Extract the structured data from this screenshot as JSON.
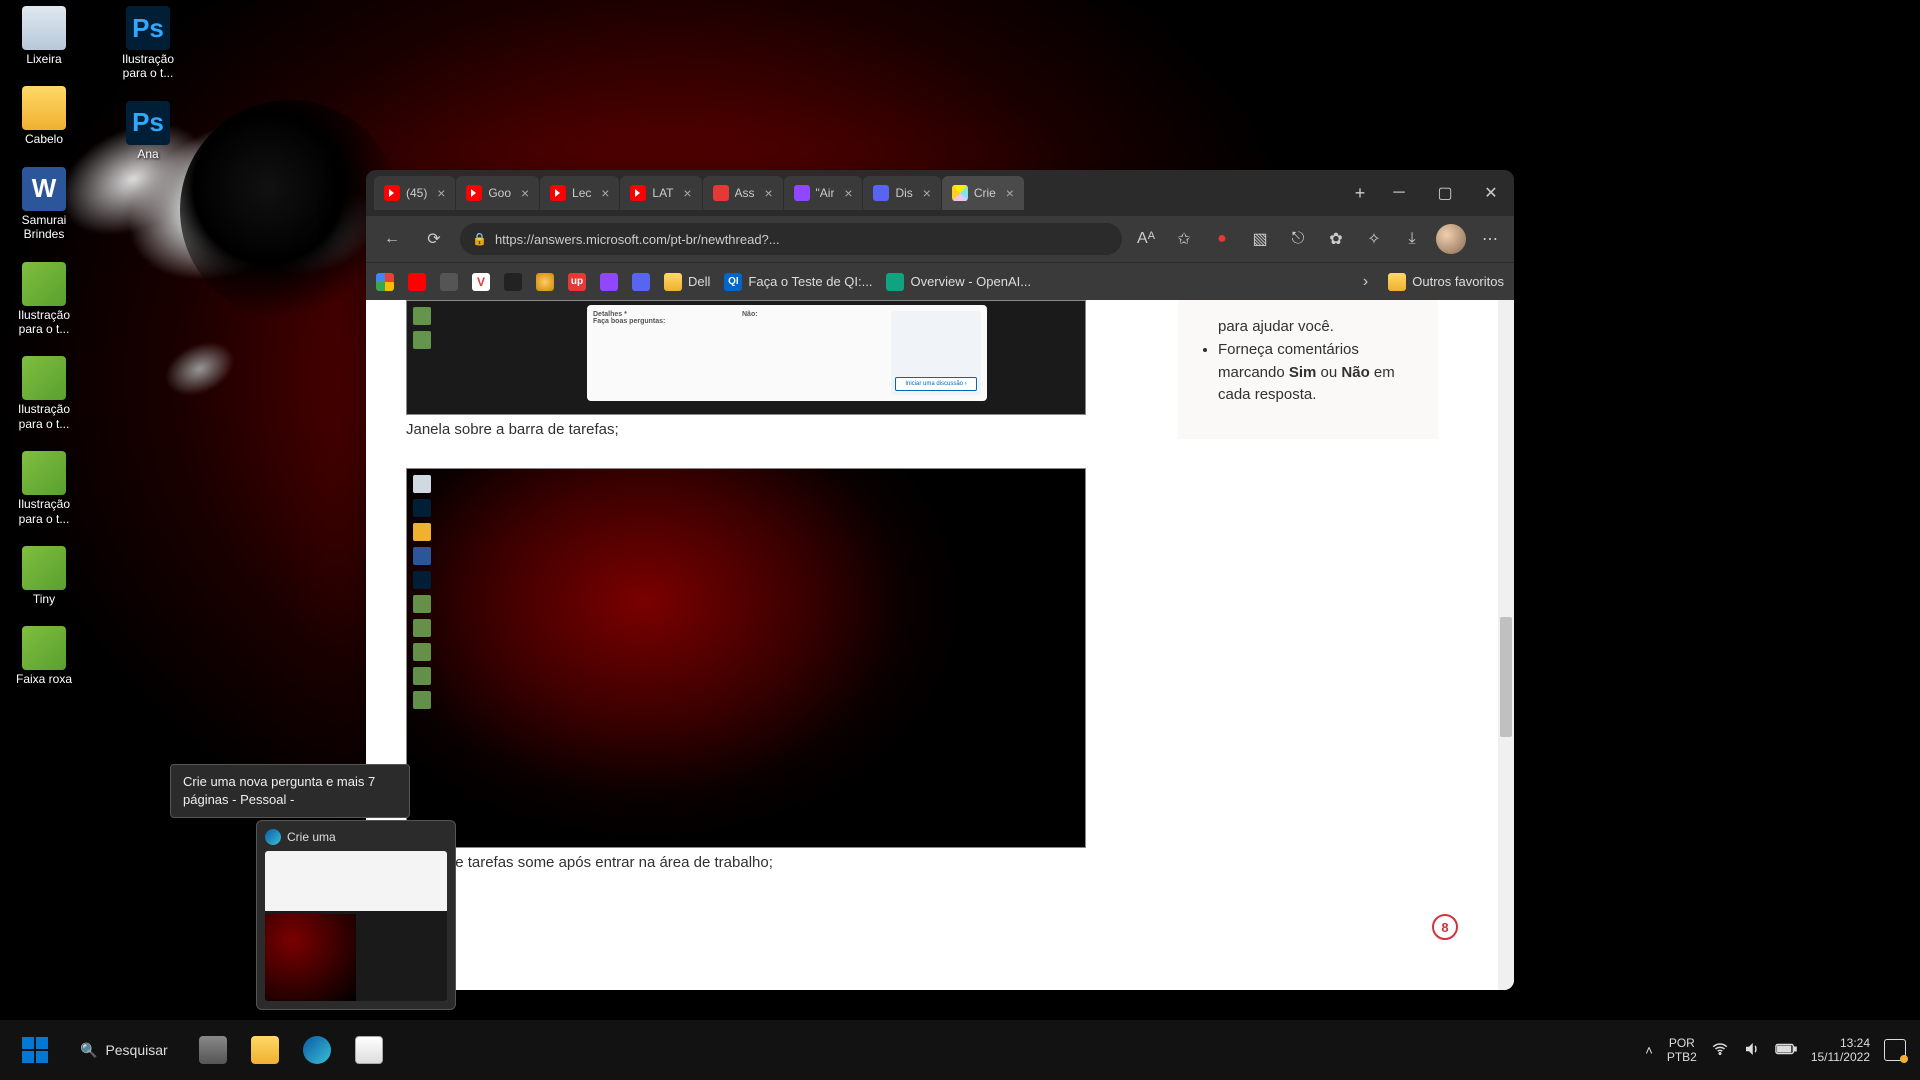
{
  "desktop_icons_col1": [
    {
      "label": "Lixeira",
      "cls": "ico-bin"
    },
    {
      "label": "Cabelo",
      "cls": "ico-folder"
    },
    {
      "label": "Samurai Brindes",
      "cls": "ico-word",
      "glyph": "W"
    },
    {
      "label": "Ilustração para o t...",
      "cls": "ico-img"
    },
    {
      "label": "Ilustração para o t...",
      "cls": "ico-img"
    },
    {
      "label": "Ilustração para o t...",
      "cls": "ico-img"
    },
    {
      "label": "Tiny",
      "cls": "ico-img"
    },
    {
      "label": "Faixa roxa",
      "cls": "ico-img"
    }
  ],
  "desktop_icons_col2": [
    {
      "label": "Ilustração para o t...",
      "cls": "ico-psd",
      "glyph": "Ps"
    },
    {
      "label": "Ana",
      "cls": "ico-psd",
      "glyph": "Ps"
    }
  ],
  "browser": {
    "tabs": [
      {
        "fav": "fav-yt",
        "label": "(45)"
      },
      {
        "fav": "fav-yt",
        "label": "Goo"
      },
      {
        "fav": "fav-yt",
        "label": "Lec"
      },
      {
        "fav": "fav-yt",
        "label": "LAT"
      },
      {
        "fav": "fav-up",
        "label": "Ass"
      },
      {
        "fav": "fav-tw",
        "label": "\"Air"
      },
      {
        "fav": "fav-dc",
        "label": "Dis"
      },
      {
        "fav": "fav-ms",
        "label": "Crie",
        "active": true
      }
    ],
    "url": "https://answers.microsoft.com/pt-br/newthread?...",
    "bookmarks": {
      "dell": "Dell",
      "ql": "Faça o Teste de QI:...",
      "openai": "Overview - OpenAI...",
      "other": "Outros favoritos"
    }
  },
  "page": {
    "caption1": "Janela sobre a barra de tarefas;",
    "caption2": "Barra de tarefas some após entrar na área de trabalho;",
    "sidebar_pre": "para ajudar você.",
    "sidebar_item": "Forneça comentários marcando ",
    "sim": "Sim",
    "ou": " ou ",
    "nao": "Não",
    "rest": " em cada resposta.",
    "badge": "8"
  },
  "tooltip": "Crie uma nova pergunta e mais 7 páginas - Pessoal -",
  "thumb_label": "Crie uma",
  "taskbar": {
    "search": "Pesquisar",
    "lang1": "POR",
    "lang2": "PTB2",
    "time": "13:24",
    "date": "15/11/2022"
  }
}
